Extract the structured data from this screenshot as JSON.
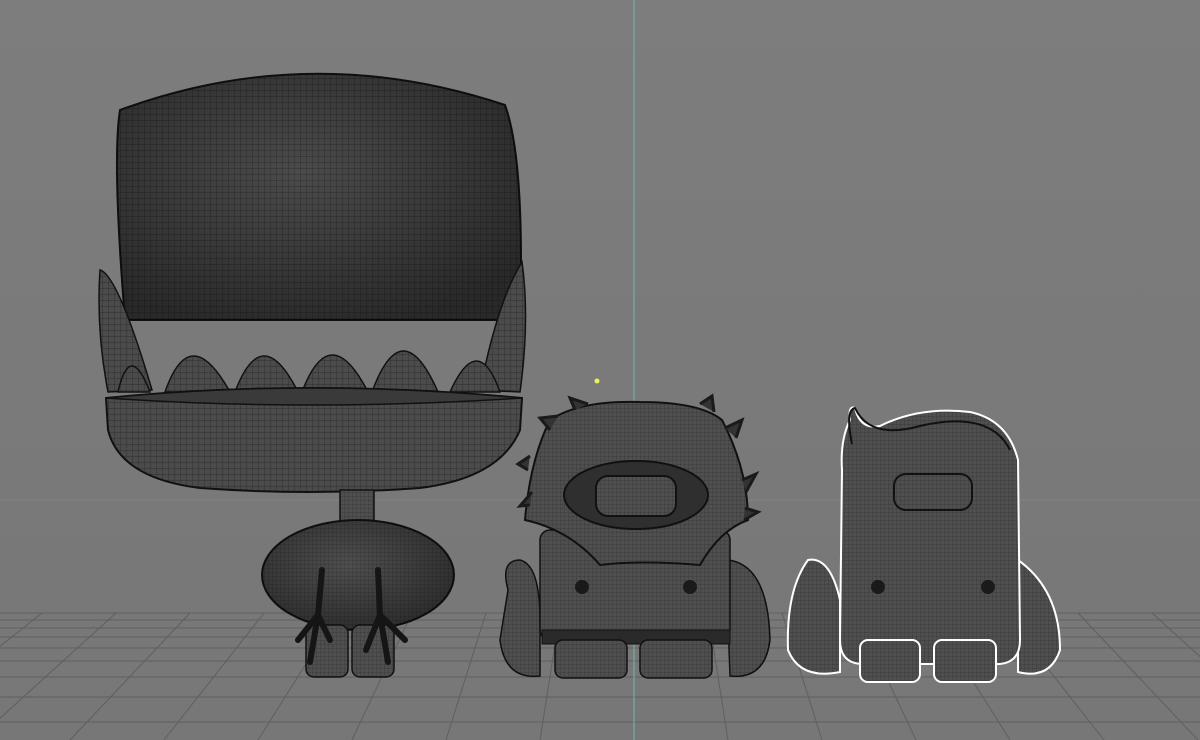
{
  "viewport": {
    "view": "perspective",
    "background_color": "#7b7b7b",
    "grid_color": "#5f5f5f",
    "axis_line_color": "#6fb9b4",
    "pivot_marker_color": "#e8f060",
    "wireframe_color": "#1c1c1c",
    "selection_outline_color": "#ffffff"
  },
  "models": [
    {
      "name": "big-hat-character",
      "selected": false
    },
    {
      "name": "spiky-hood-character",
      "selected": false
    },
    {
      "name": "hair-curl-character",
      "selected": true
    }
  ]
}
